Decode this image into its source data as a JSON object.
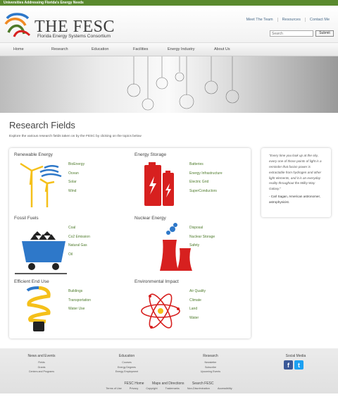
{
  "topbar": {
    "tagline": "Universities Addressing Florida's Energy Needs"
  },
  "header": {
    "logo_title": "THE FESC",
    "logo_subtitle": "Florida Energy Systems Consortium",
    "links": [
      "Meet The Team",
      "Resources",
      "Contact Me"
    ],
    "search": {
      "placeholder": "Search",
      "button": "Submit"
    }
  },
  "nav": {
    "items": [
      "Home",
      "Research",
      "Education",
      "Facilities",
      "Energy Industry",
      "About Us"
    ]
  },
  "main": {
    "title": "Research Fields",
    "intro": "Explore the various research fields taken on by the FESC by clicking on the topics below",
    "categories": [
      {
        "title": "Renewable Energy",
        "icon": "wind-turbine-icon",
        "links": [
          "BioEnergy",
          "Ocean",
          "Solar",
          "Wind"
        ]
      },
      {
        "title": "Energy Storage",
        "icon": "battery-icon",
        "links": [
          "Batteries",
          "Energy Infrastructure",
          "Electric Grid",
          "SuperConductors"
        ]
      },
      {
        "title": "Fossil Fuels",
        "icon": "coal-cart-icon",
        "links": [
          "Coal",
          "Co2 Emission",
          "Natural Gas",
          "Oil"
        ]
      },
      {
        "title": "Nuclear Energy",
        "icon": "cooling-tower-icon",
        "links": [
          "Disposal",
          "Nuclear Storage",
          "Safety"
        ]
      },
      {
        "title": "Efficient End Use",
        "icon": "cfl-bulb-icon",
        "links": [
          "Buildings",
          "Transportation",
          "Water Use"
        ]
      },
      {
        "title": "Environmental Impact",
        "icon": "atom-icon",
        "links": [
          "Air Quality",
          "Climate",
          "Land",
          "Water"
        ]
      }
    ]
  },
  "quote": {
    "text": "\"Every time you look up at the sky, every one of those points of light is a reminder that fusion power is extractable from hydrogen and other light elements, and it is an everyday reality throughout the Milky Way Galaxy.\"",
    "author": "- Carl Sagan, American astronomer, astrophysicist."
  },
  "footer": {
    "columns": [
      {
        "heading": "News and Events",
        "items": [
          "Fields",
          "Grants",
          "Centers and Programs"
        ]
      },
      {
        "heading": "Education",
        "items": [
          "Courses",
          "Energy Degrees",
          "Energy Employment"
        ]
      },
      {
        "heading": "Research",
        "items": [
          "Newsletter",
          "Subscribe",
          "Upcoming Events"
        ]
      },
      {
        "heading": "Social Media",
        "items": []
      }
    ],
    "row1": [
      "FESC Home",
      "Maps and Directions",
      "Search FESC"
    ],
    "row2": [
      "Terms of Use",
      "Privacy",
      "Copyright",
      "Trademarks",
      "Non-Discrimination",
      "Accessibility"
    ],
    "social": [
      {
        "icon": "facebook-icon",
        "glyph": "f",
        "color": "#3b5998"
      },
      {
        "icon": "twitter-icon",
        "glyph": "t",
        "color": "#1da1f2"
      }
    ]
  },
  "colors": {
    "accent_green": "#5a8a2e",
    "link_green": "#4d7a2a",
    "battery_red": "#d7201f",
    "renewable_blue": "#2e78c9"
  }
}
